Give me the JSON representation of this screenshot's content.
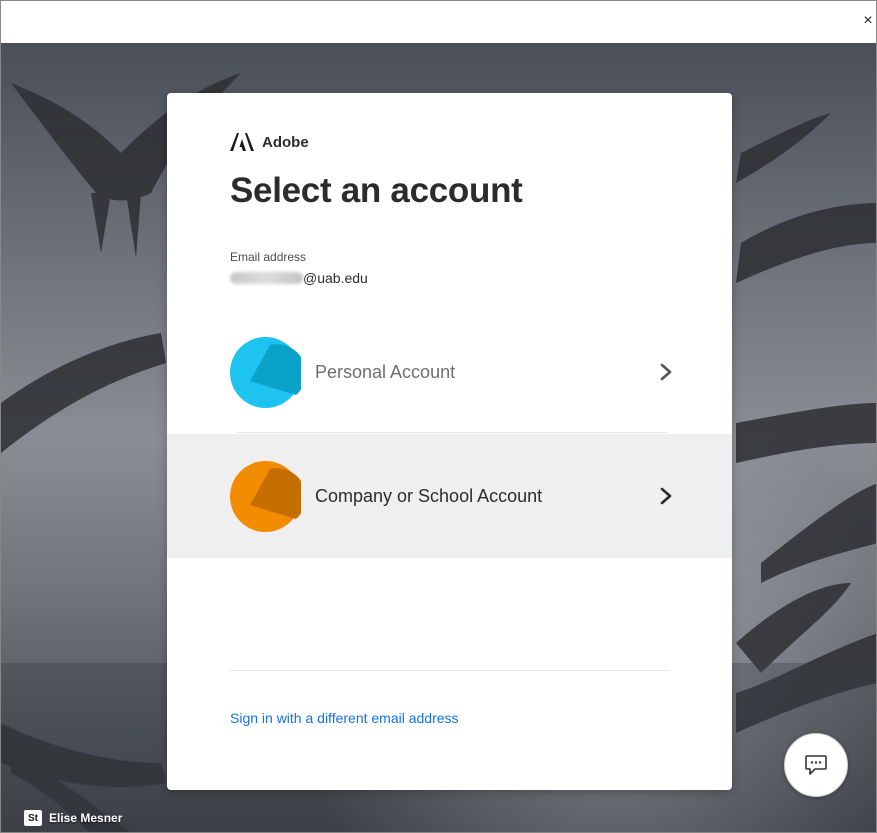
{
  "window": {
    "close_glyph": "×"
  },
  "brand": {
    "name": "Adobe",
    "logo_icon": "adobe-logo-icon"
  },
  "heading": "Select an account",
  "email": {
    "label": "Email address",
    "value": "@uab.edu"
  },
  "accounts": [
    {
      "label": "Personal Account",
      "icon": "personal-account-icon",
      "color": "#1ec3f0"
    },
    {
      "label": "Company or School Account",
      "icon": "company-account-icon",
      "color": "#f28c00"
    }
  ],
  "signin_link": "Sign in with a different email address",
  "feedback": {
    "icon": "chat-bubble-icon"
  },
  "credit": {
    "badge": "St",
    "name": "Elise Mesner"
  },
  "colors": {
    "link": "#1473e6",
    "heading": "#2c2c2c",
    "selected_row": "#efefef"
  }
}
